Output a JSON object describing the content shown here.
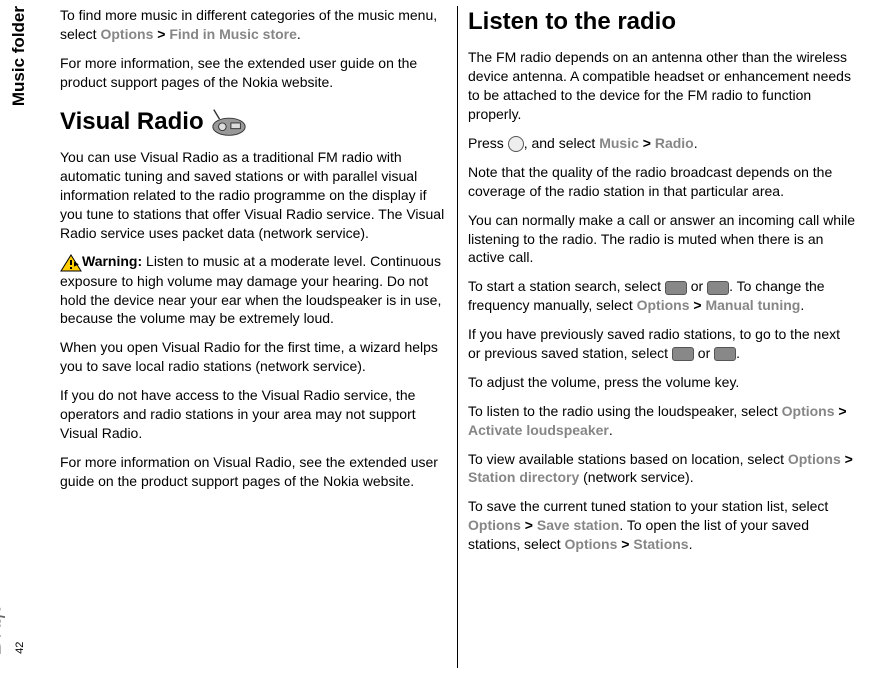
{
  "sidebar": {
    "section_label": "Music folder",
    "draft_label": "Draft",
    "page_number": "42"
  },
  "col_left": {
    "intro_p1_a": "To find more music in different categories of the music menu, select ",
    "intro_options": "Options",
    "intro_gt": " > ",
    "intro_find": "Find in Music store",
    "intro_p1_b": ".",
    "intro_p2": "For more information, see the extended user guide on the product support pages of the Nokia website.",
    "heading": "Visual Radio",
    "vr_p1": "You can use Visual Radio as a traditional FM radio with automatic tuning and saved stations or with parallel visual information related to the radio programme on the display if you tune to stations that offer Visual Radio service. The Visual Radio service uses packet data (network service).",
    "warning_label": "Warning:  ",
    "warning_text": "Listen to music at a moderate level. Continuous exposure to high volume may damage your hearing. Do not hold the device near your ear when the loudspeaker is in use, because the volume may be extremely loud.",
    "vr_p2": "When you open Visual Radio for the first time, a wizard helps you to save local radio stations (network service).",
    "vr_p3": "If you do not have access to the Visual Radio service, the operators and radio stations in your area may not support Visual Radio.",
    "vr_p4": "For more information on Visual Radio, see the extended user guide on the product support pages of the Nokia website."
  },
  "col_right": {
    "heading": "Listen to the radio",
    "p1": "The FM radio depends on an antenna other than the wireless device antenna. A compatible headset or enhancement needs to be attached to the device for the FM radio to function properly.",
    "p2_a": "Press ",
    "p2_b": ", and select ",
    "p2_music": "Music",
    "p2_gt": " > ",
    "p2_radio": "Radio",
    "p2_c": ".",
    "p3": "Note that the quality of the radio broadcast depends on the coverage of the radio station in that particular area.",
    "p4": "You can normally make a call or answer an incoming call while listening to the radio. The radio is muted when there is an active call.",
    "p5_a": "To start a station search, select ",
    "p5_b": " or ",
    "p5_c": ". To change the frequency manually, select ",
    "p5_options": "Options",
    "p5_gt": " > ",
    "p5_manual": "Manual tuning",
    "p5_d": ".",
    "p6_a": "If you have previously saved radio stations, to go to the next or previous saved station, select ",
    "p6_b": " or ",
    "p6_c": ".",
    "p7": "To adjust the volume, press the volume key.",
    "p8_a": "To listen to the radio using the loudspeaker, select ",
    "p8_options": "Options",
    "p8_gt": " > ",
    "p8_loud": "Activate loudspeaker",
    "p8_b": ".",
    "p9_a": "To view available stations based on location, select ",
    "p9_options": "Options",
    "p9_gt": " > ",
    "p9_dir": "Station directory",
    "p9_b": " (network service).",
    "p10_a": "To save the current tuned station to your station list, select ",
    "p10_options": "Options",
    "p10_gt": " > ",
    "p10_save": "Save station",
    "p10_b": ". To open the list of your saved stations, select ",
    "p10_options2": "Options",
    "p10_gt2": " > ",
    "p10_stations": "Stations",
    "p10_c": "."
  }
}
